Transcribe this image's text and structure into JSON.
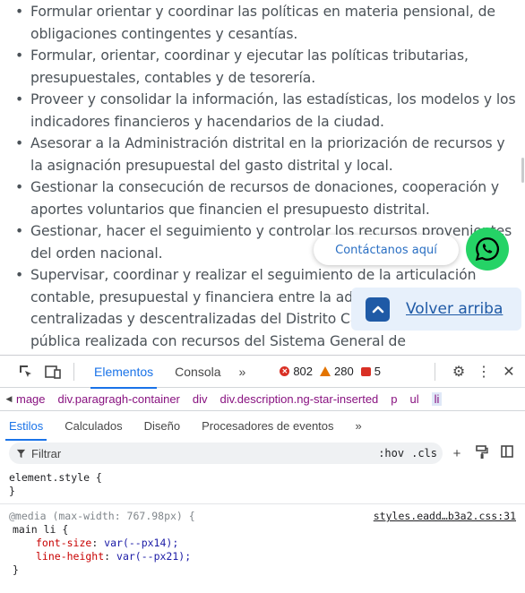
{
  "page": {
    "bullets": [
      "Formular orientar y coordinar las políticas en materia pensional, de obligaciones contingentes y cesantías.",
      "Formular, orientar, coordinar y ejecutar las políticas tributarias, presupuestales, contables y de tesorería.",
      "Proveer y consolidar la información, las estadísticas, los modelos y los indicadores financieros y hacendarios de la ciudad.",
      "Asesorar a la Administración distrital en la priorización de recursos y la asignación presupuestal del gasto distrital y local.",
      "Gestionar la consecución de recursos de donaciones, cooperación y aportes voluntarios que financien el presupuesto distrital.",
      "Gestionar, hacer el seguimiento y controlar los recursos provenientes del orden nacional.",
      "Supervisar, coordinar y realizar el seguimiento de la articulación contable, presupuestal y financiera entre la administración centralizadas y descentralizadas del Distrito Capital y de la inversión pública realizada con recursos del Sistema General de"
    ],
    "whatsapp_label": "Contáctanos aquí",
    "back_to_top_label": "Volver arriba"
  },
  "devtools": {
    "tabs": [
      "Elementos",
      "Consola"
    ],
    "more_tabs": "»",
    "counters": {
      "errors": "802",
      "warnings": "280",
      "issues": "5"
    },
    "breadcrumbs": [
      "mage",
      "div.paragragh-container",
      "div",
      "div.description.ng-star-inserted",
      "p",
      "ul",
      "li"
    ],
    "subtabs": [
      "Estilos",
      "Calculados",
      "Diseño",
      "Procesadores de eventos"
    ],
    "subtabs_more": "»",
    "filter_placeholder": "Filtrar",
    "filter_options": {
      "hov": ":hov",
      "cls": ".cls"
    },
    "styles": {
      "element_style_open": "element.style {",
      "close_brace": "}",
      "media_query": "@media (max-width: 767.98px) {",
      "source": "styles.eadd…b3a2.css:31",
      "selector": "main li {",
      "props": [
        {
          "name": "font-size",
          "value": "var(--px14);"
        },
        {
          "name": "line-height",
          "value": "var(--px21);"
        }
      ]
    }
  },
  "colors": {
    "accent": "#1a73e8",
    "whatsapp": "#25d366",
    "back_to_top": "#1f5aa6"
  }
}
